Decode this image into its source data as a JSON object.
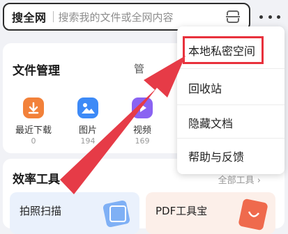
{
  "search": {
    "scope_label": "搜全网",
    "placeholder": "搜索我的文件或全网内容"
  },
  "file_management": {
    "title": "文件管理",
    "more_partial": "管",
    "items": [
      {
        "label": "最近下载",
        "count": "0",
        "icon": "download-icon",
        "color": "#f2813a"
      },
      {
        "label": "图片",
        "count": "194",
        "icon": "image-icon",
        "color": "#3d8af7"
      },
      {
        "label": "视频",
        "count": "169",
        "icon": "video-icon",
        "color": "#8a63f2"
      }
    ]
  },
  "efficiency_tools": {
    "title": "效率工具",
    "more": "全部工具 ›",
    "tiles": [
      {
        "label": "拍照扫描",
        "icon": "scan-icon"
      },
      {
        "label": "PDF工具宝",
        "icon": "pdf-icon"
      }
    ]
  },
  "menu": {
    "items": [
      "本地私密空间",
      "回收站",
      "隐藏文档",
      "帮助与反馈"
    ]
  },
  "colors": {
    "annotation_red": "#e8313c",
    "annotation_arrow": "#e63b47"
  }
}
